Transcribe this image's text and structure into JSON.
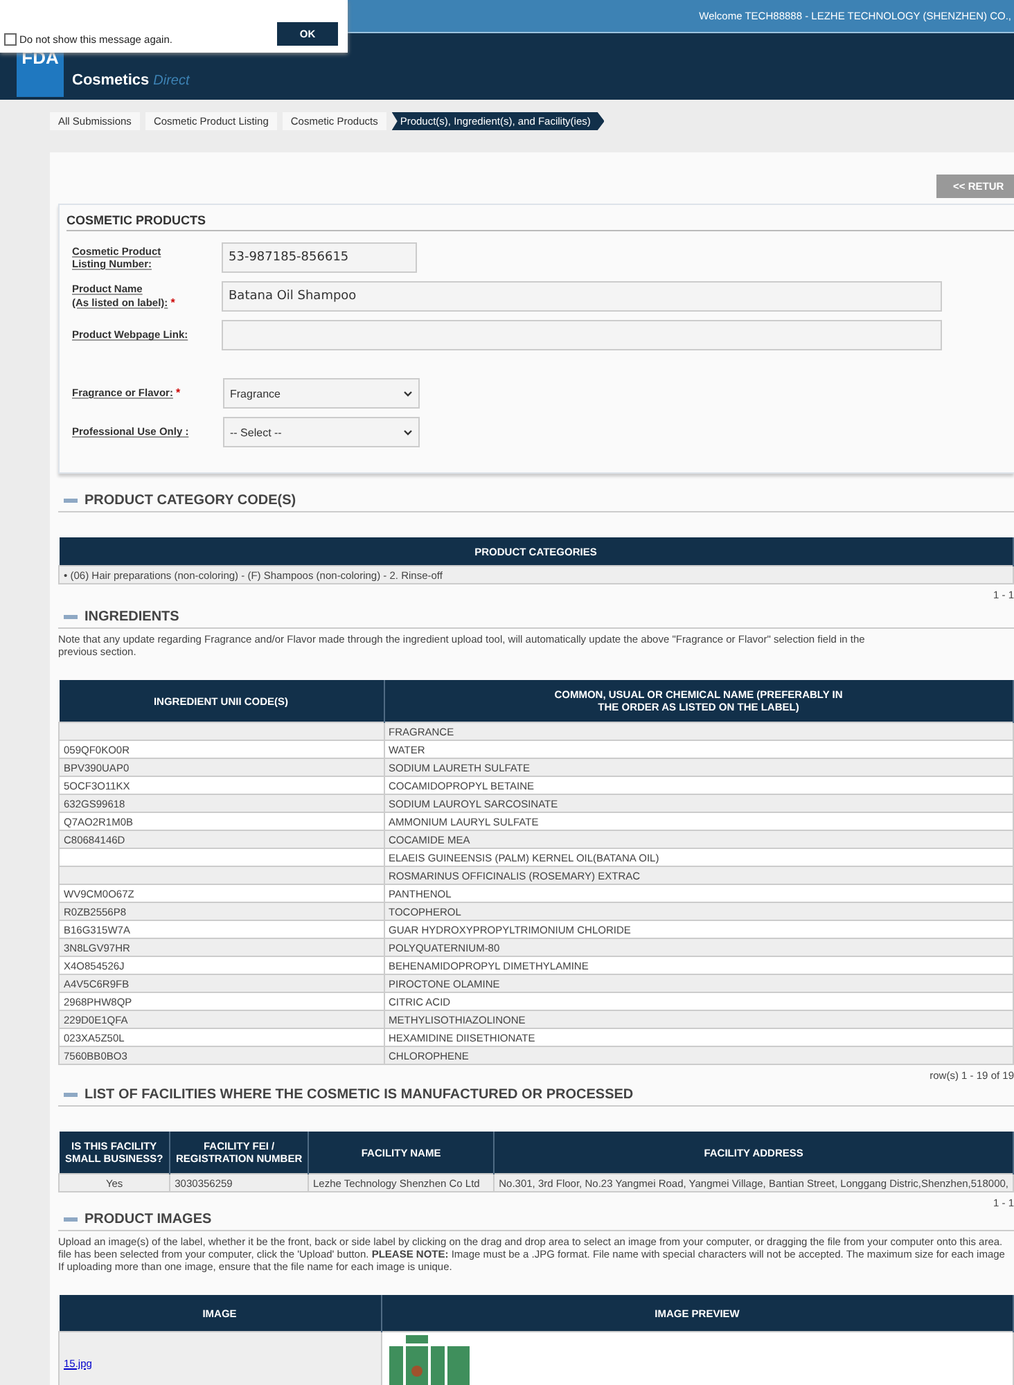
{
  "dialog": {
    "checkbox_label": "Do not show this message again.",
    "checked": false,
    "ok_button": "OK"
  },
  "top_bar": {
    "welcome": "Welcome TECH88888 - LEZHE TECHNOLOGY (SHENZHEN) CO.,"
  },
  "header": {
    "logo_box": "FDA",
    "logo_title": "Cosmetics",
    "logo_subtitle": "Direct"
  },
  "breadcrumb": [
    {
      "label": "All Submissions",
      "selected": false
    },
    {
      "label": "Cosmetic Product Listing",
      "selected": false
    },
    {
      "label": "Cosmetic Products",
      "selected": false
    },
    {
      "label": "Product(s), Ingredient(s), and Facility(ies)",
      "selected": true
    }
  ],
  "return_button": "<< RETUR",
  "cosmetic_products": {
    "title": "COSMETIC PRODUCTS",
    "required_mark": "*",
    "fields": [
      {
        "kind": "input",
        "label_lines": [
          "Cosmetic Product",
          "Listing Number:"
        ],
        "required": false,
        "value": "53-987185-856615",
        "wide": false
      },
      {
        "kind": "input",
        "label_lines": [
          "Product Name",
          "(As listed on label):"
        ],
        "required": true,
        "value": "Batana Oil Shampoo",
        "wide": true
      },
      {
        "kind": "input",
        "label_lines": [
          "Product Webpage Link:"
        ],
        "required": false,
        "wide": true
      },
      {
        "kind": "select",
        "label_lines": [
          "Fragrance or Flavor:"
        ],
        "required": true,
        "value": "Fragrance"
      },
      {
        "kind": "select",
        "label_lines": [
          "Professional Use Only :"
        ],
        "required": false,
        "value": "-- Select --"
      }
    ]
  },
  "category_section": {
    "title": "PRODUCT CATEGORY CODE(S)",
    "bullet": "•",
    "column": "PRODUCT CATEGORIES",
    "rows": [
      "(06) Hair preparations (non-coloring) - (F) Shampoos (non-coloring) - 2. Rinse-off"
    ],
    "pager": "1 - 1"
  },
  "ingredients_section": {
    "title": "INGREDIENTS",
    "note": "Note that any update regarding Fragrance and/or Flavor made through the ingredient upload tool, will automatically update the above \"Fragrance or Flavor\" selection field in the previous section.",
    "columns": [
      "INGREDIENT UNII CODE(S)",
      "COMMON, USUAL OR CHEMICAL NAME (PREFERABLY IN THE ORDER AS LISTED ON THE LABEL)"
    ],
    "rows": [
      [
        "",
        "FRAGRANCE"
      ],
      [
        "059QF0KO0R",
        "WATER"
      ],
      [
        "BPV390UAP0",
        "SODIUM LAURETH SULFATE"
      ],
      [
        "5OCF3O11KX",
        "COCAMIDOPROPYL BETAINE"
      ],
      [
        "632GS99618",
        "SODIUM LAUROYL SARCOSINATE"
      ],
      [
        "Q7AO2R1M0B",
        "AMMONIUM LAURYL SULFATE"
      ],
      [
        "C80684146D",
        "COCAMIDE MEA"
      ],
      [
        "",
        "ELAEIS GUINEENSIS (PALM) KERNEL OIL(BATANA OIL)"
      ],
      [
        "",
        "ROSMARINUS OFFICINALIS (ROSEMARY) EXTRAC"
      ],
      [
        "WV9CM0O67Z",
        "PANTHENOL"
      ],
      [
        "R0ZB2556P8",
        "TOCOPHEROL"
      ],
      [
        "B16G315W7A",
        "GUAR HYDROXYPROPYLTRIMONIUM CHLORIDE"
      ],
      [
        "3N8LGV97HR",
        "POLYQUATERNIUM-80"
      ],
      [
        "X4O854526J",
        "BEHENAMIDOPROPYL DIMETHYLAMINE"
      ],
      [
        "A4V5C6R9FB",
        "PIROCTONE OLAMINE"
      ],
      [
        "2968PHW8QP",
        "CITRIC ACID"
      ],
      [
        "229D0E1QFA",
        "METHYLISOTHIAZOLINONE"
      ],
      [
        "023XA5Z50L",
        "HEXAMIDINE DIISETHIONATE"
      ],
      [
        "7560BB0BO3",
        "CHLOROPHENE"
      ]
    ],
    "pager": "row(s) 1 - 19 of 19"
  },
  "facilities_section": {
    "title": "LIST OF FACILITIES WHERE THE COSMETIC IS MANUFACTURED OR PROCESSED",
    "columns": [
      "IS THIS FACILITY SMALL BUSINESS?",
      "FACILITY FEI / REGISTRATION NUMBER",
      "FACILITY NAME",
      "FACILITY ADDRESS"
    ],
    "rows": [
      [
        "Yes",
        "3030356259",
        "Lezhe Technology Shenzhen Co Ltd",
        "No.301, 3rd Floor, No.23 Yangmei Road, Yangmei Village, Bantian Street, Longgang Distric,Shenzhen,518000,"
      ]
    ],
    "pager": "1 - 1"
  },
  "images_section": {
    "title": "PRODUCT IMAGES",
    "note_lines": [
      "Upload an image(s) of the label, whether it be the front, back or side label by clicking on the drag and drop area to select an image from your computer, or dragging the file from your computer onto this area.",
      "file has been selected from your computer, click the 'Upload' button. **PLEASE NOTE:** Image must be a .JPG format. File name with special characters will not be accepted. The maximum size for each image",
      "If uploading more than one image, ensure that the file name for each image is unique."
    ],
    "columns": [
      "IMAGE",
      "IMAGE PREVIEW"
    ],
    "rows": [
      {
        "file": "15.jpg"
      }
    ]
  }
}
